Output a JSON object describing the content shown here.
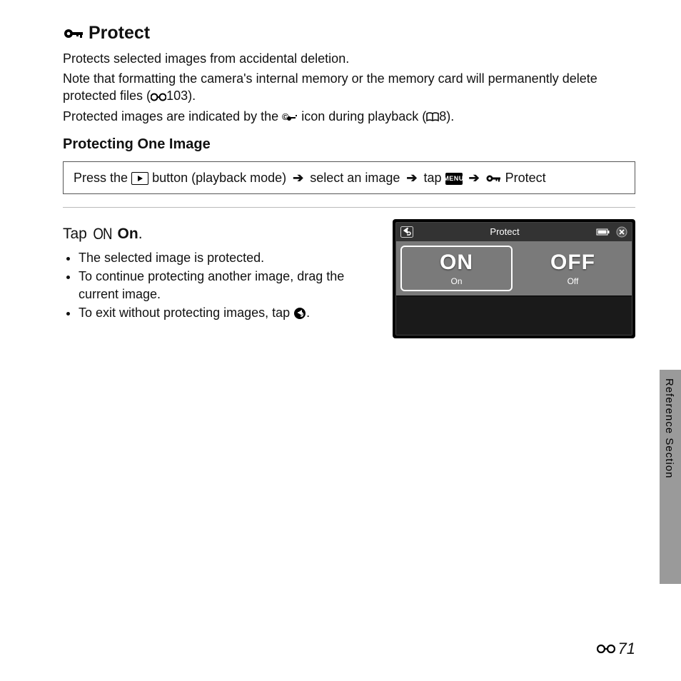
{
  "title": "Protect",
  "para1": "Protects selected images from accidental deletion.",
  "para2_a": "Note that formatting the camera's internal memory or the memory card will permanently delete protected files (",
  "para2_ref": "103).",
  "para3_a": "Protected images are indicated by the ",
  "para3_b": " icon during playback (",
  "para3_ref": "8).",
  "subheading": "Protecting One Image",
  "steps": {
    "a": "Press the ",
    "b": " button (playback mode) ",
    "arrow": "➔",
    "c": " select an image ",
    "d": " tap ",
    "menu": "MENU",
    "e": " Protect"
  },
  "step_title_a": "Tap ",
  "step_title_on": "ON",
  "step_title_b": " On",
  "bullets": [
    "The selected image is protected.",
    "To continue protecting another image, drag the current image.",
    "To exit without protecting images, tap "
  ],
  "bullet3_suffix": ".",
  "lcd": {
    "title": "Protect",
    "on_big": "ON",
    "on_small": "On",
    "off_big": "OFF",
    "off_small": "Off"
  },
  "side_label": "Reference Section",
  "page_number": "71"
}
